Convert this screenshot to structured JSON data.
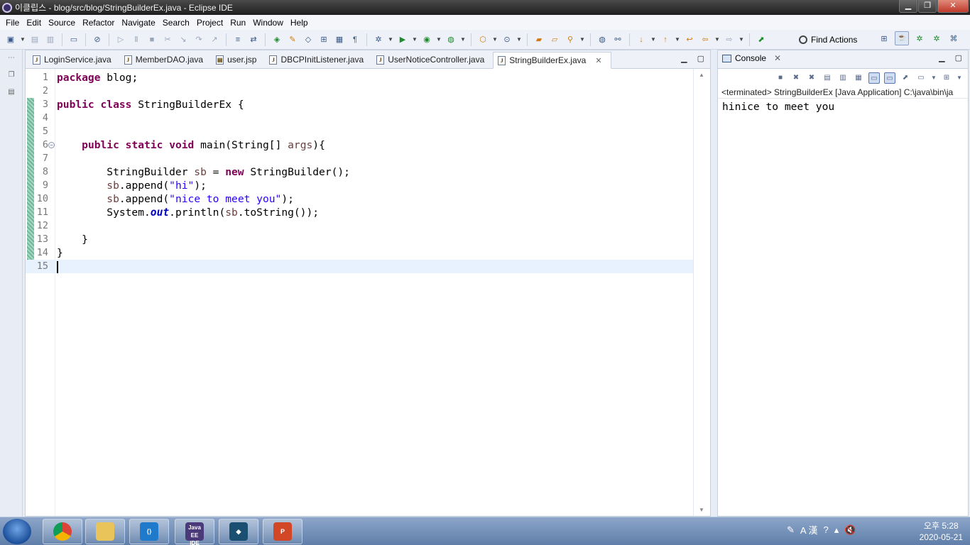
{
  "window": {
    "title": "이클립스 - blog/src/blog/StringBuilderEx.java - Eclipse IDE"
  },
  "menu": [
    "File",
    "Edit",
    "Source",
    "Refactor",
    "Navigate",
    "Search",
    "Project",
    "Run",
    "Window",
    "Help"
  ],
  "toolbar": {
    "find_actions": "Find Actions"
  },
  "editor": {
    "tabs": [
      "LoginService.java",
      "MemberDAO.java",
      "user.jsp",
      "DBCPInitListener.java",
      "UserNoticeController.java",
      "StringBuilderEx.java"
    ],
    "active_tab": "StringBuilderEx.java",
    "lines": [
      {
        "n": "1",
        "text": "package blog;"
      },
      {
        "n": "2",
        "text": ""
      },
      {
        "n": "3",
        "text": "public class StringBuilderEx {"
      },
      {
        "n": "4",
        "text": ""
      },
      {
        "n": "5",
        "text": ""
      },
      {
        "n": "6",
        "text": "    public static void main(String[] args){"
      },
      {
        "n": "7",
        "text": ""
      },
      {
        "n": "8",
        "text": "        StringBuilder sb = new StringBuilder();"
      },
      {
        "n": "9",
        "text": "        sb.append(\"hi\");"
      },
      {
        "n": "10",
        "text": "        sb.append(\"nice to meet you\");"
      },
      {
        "n": "11",
        "text": "        System.out.println(sb.toString());"
      },
      {
        "n": "12",
        "text": ""
      },
      {
        "n": "13",
        "text": "    }"
      },
      {
        "n": "14",
        "text": "}"
      },
      {
        "n": "15",
        "text": ""
      }
    ]
  },
  "console": {
    "tab_label": "Console",
    "status": "<terminated> StringBuilderEx [Java Application] C:\\java\\bin\\ja",
    "output": "hinice to meet you"
  },
  "taskbar": {
    "apps": [
      "chrome",
      "file-explorer",
      "vscode",
      "Java EE IDE",
      "mysql-workbench",
      "powerpoint"
    ],
    "time": "오후 5:28",
    "date": "2020-05-21",
    "ime": "A 漢"
  }
}
